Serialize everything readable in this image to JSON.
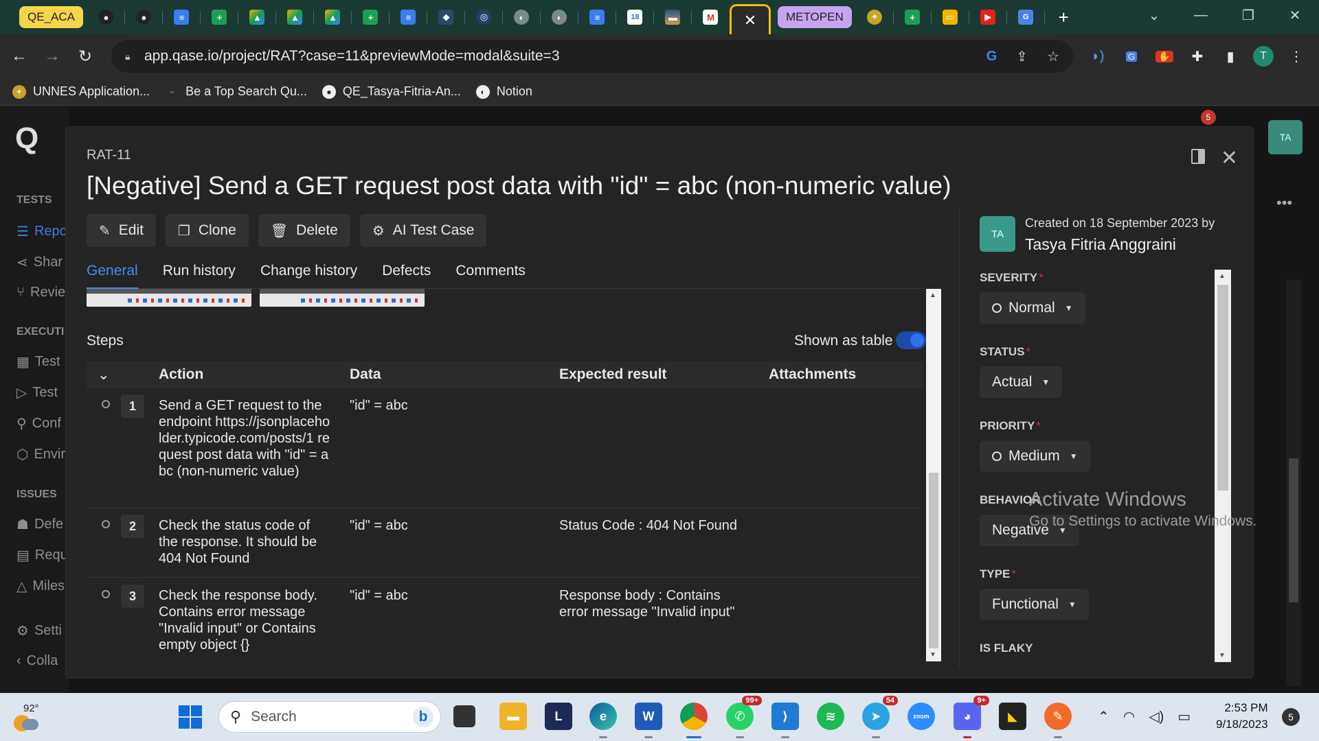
{
  "browser": {
    "tab_group_1": "QE_ACA",
    "tab_group_2": "METOPEN",
    "active_tab_close": "✕",
    "url": "app.qase.io/project/RAT?case=11&previewMode=modal&suite=3",
    "profile_initial": "T",
    "bookmarks": [
      {
        "label": "UNNES Application..."
      },
      {
        "label": "Be a Top Search Qu..."
      },
      {
        "label": "QE_Tasya-Fitria-An..."
      },
      {
        "label": "Notion"
      }
    ]
  },
  "sidebar": {
    "logo": "Q",
    "sections": [
      {
        "label": "TESTS"
      },
      {
        "label": "EXECUTI"
      },
      {
        "label": "ISSUES"
      }
    ],
    "items": [
      {
        "label": "Repo"
      },
      {
        "label": "Shar"
      },
      {
        "label": "Revie"
      },
      {
        "label": "Test"
      },
      {
        "label": "Test"
      },
      {
        "label": "Conf"
      },
      {
        "label": "Envir"
      },
      {
        "label": "Defe"
      },
      {
        "label": "Requ"
      },
      {
        "label": "Miles"
      },
      {
        "label": "Setti"
      },
      {
        "label": "Colla"
      }
    ]
  },
  "header_right": {
    "avatar": "TA",
    "notification_count": "5"
  },
  "modal": {
    "case_id": "RAT-11",
    "title": "[Negative] Send a GET request post data with \"id\" = abc (non-numeric value)",
    "actions": [
      {
        "label": "Edit",
        "icon": "pencil-icon"
      },
      {
        "label": "Clone",
        "icon": "clone-icon"
      },
      {
        "label": "Delete",
        "icon": "trash-icon"
      },
      {
        "label": "AI Test Case",
        "icon": "ai-chip-icon"
      }
    ],
    "tabs": [
      {
        "label": "General",
        "active": true
      },
      {
        "label": "Run history"
      },
      {
        "label": "Change history"
      },
      {
        "label": "Defects"
      },
      {
        "label": "Comments"
      }
    ],
    "steps": {
      "heading": "Steps",
      "toggle_label": "Shown as table",
      "toggle_on": true,
      "columns": [
        "Action",
        "Data",
        "Expected result",
        "Attachments"
      ],
      "rows": [
        {
          "num": "1",
          "action": "Send a GET request to the endpoint https://jsonplaceholder.typicode.com/posts/1 request post data with \"id\" = abc (non-numeric value)",
          "data": "\"id\" = abc",
          "expected": ""
        },
        {
          "num": "2",
          "action": "Check the status code of the response. It should be 404 Not Found",
          "data": "\"id\" = abc",
          "expected": "Status Code : 404 Not Found"
        },
        {
          "num": "3",
          "action": "Check the response body. Contains error message \"Invalid input\" or Contains empty object {}",
          "data": "\"id\" = abc",
          "expected": "Response body : Contains error message \"Invalid input\""
        }
      ]
    },
    "meta": {
      "avatar": "TA",
      "created_text": "Created on 18 September 2023 by",
      "author": "Tasya Fitria Anggraini",
      "fields": [
        {
          "label": "SEVERITY",
          "value": "Normal",
          "ring": true
        },
        {
          "label": "STATUS",
          "value": "Actual",
          "ring": false
        },
        {
          "label": "PRIORITY",
          "value": "Medium",
          "ring": true
        },
        {
          "label": "BEHAVIOR",
          "value": "Negative",
          "ring": false
        },
        {
          "label": "TYPE",
          "value": "Functional",
          "ring": false
        }
      ],
      "flaky_label": "IS FLAKY"
    },
    "watermark": {
      "line1": "Activate Windows",
      "line2": "Go to Settings to activate Windows."
    }
  },
  "taskbar": {
    "weather_temp": "92°",
    "search_placeholder": "Search",
    "whatsapp_badge": "99+",
    "telegram_badge": "54",
    "discord_badge": "9+",
    "time": "2:53 PM",
    "date": "9/18/2023",
    "notification_count": "5"
  },
  "colors": {
    "accent": "#4a8de8",
    "required": "#c0392b",
    "tab_group_yellow": "#f7d54a",
    "tab_group_purple": "#c7a4f0"
  }
}
